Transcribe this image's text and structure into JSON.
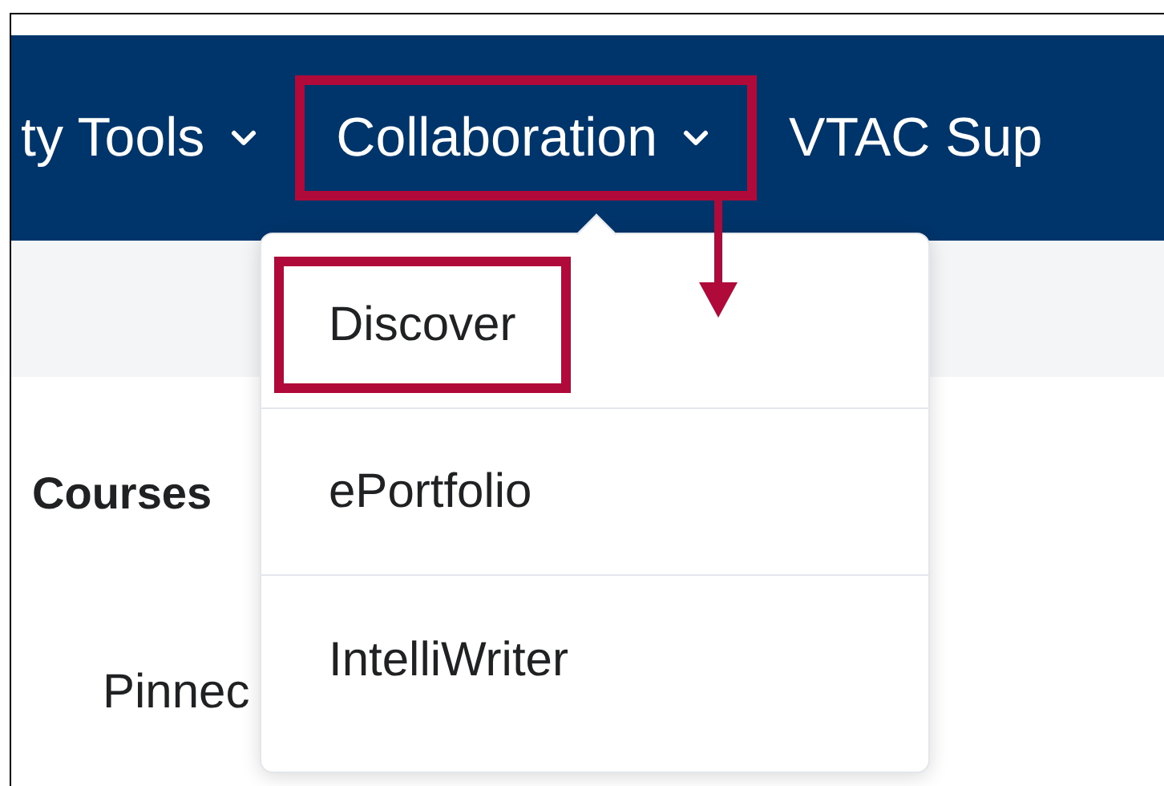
{
  "nav": {
    "items": [
      {
        "label": "ty Tools",
        "has_menu": true,
        "highlighted": false
      },
      {
        "label": "Collaboration",
        "has_menu": true,
        "highlighted": true
      },
      {
        "label": "VTAC Sup",
        "has_menu": false,
        "highlighted": false
      }
    ]
  },
  "dropdown": {
    "items": [
      {
        "label": "Discover",
        "highlighted": true
      },
      {
        "label": "ePortfolio",
        "highlighted": false
      },
      {
        "label": "IntelliWriter",
        "highlighted": false
      }
    ]
  },
  "content": {
    "heading": "Courses",
    "row": "Pinnec"
  }
}
